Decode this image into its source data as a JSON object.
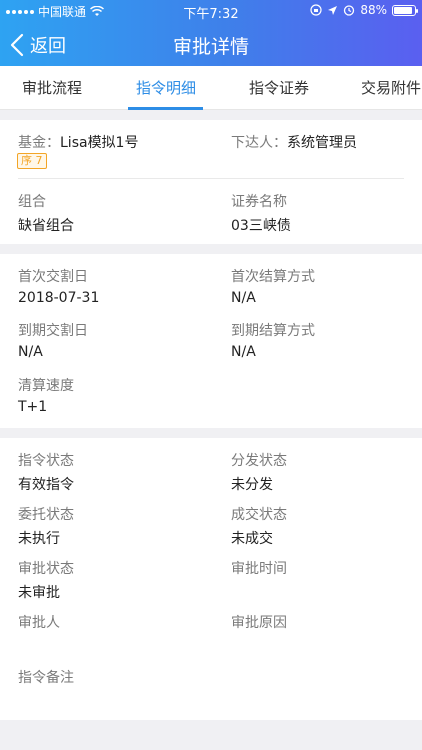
{
  "status_bar": {
    "carrier": "中国联通",
    "time": "下午7:32",
    "battery": "88%",
    "battery_level": 0.88
  },
  "nav": {
    "back_label": "返回",
    "title": "审批详情"
  },
  "tabs": [
    {
      "label": "审批流程"
    },
    {
      "label": "指令明细"
    },
    {
      "label": "指令证券"
    },
    {
      "label": "交易附件"
    }
  ],
  "summary": {
    "fund_label": "基金：",
    "fund_value": "Lisa模拟1号",
    "issuer_label": "下达人：",
    "issuer_value": "系统管理员",
    "badge_char": "序",
    "badge_num": "7",
    "portfolio_label": "组合",
    "portfolio_value": "缺省组合",
    "security_label": "证券名称",
    "security_value": "03三峡债"
  },
  "settlement": {
    "first_delivery_label": "首次交割日",
    "first_delivery_value": "2018-07-31",
    "first_settle_label": "首次结算方式",
    "first_settle_value": "N/A",
    "maturity_delivery_label": "到期交割日",
    "maturity_delivery_value": "N/A",
    "maturity_settle_label": "到期结算方式",
    "maturity_settle_value": "N/A",
    "clearing_label": "清算速度",
    "clearing_value": "T+1"
  },
  "status": {
    "order_status_label": "指令状态",
    "order_status_value": "有效指令",
    "dispatch_label": "分发状态",
    "dispatch_value": "未分发",
    "entrust_label": "委托状态",
    "entrust_value": "未执行",
    "deal_label": "成交状态",
    "deal_value": "未成交",
    "approval_status_label": "审批状态",
    "approval_status_value": "未审批",
    "approval_time_label": "审批时间",
    "approver_label": "审批人",
    "approval_reason_label": "审批原因",
    "remark_label": "指令备注"
  }
}
